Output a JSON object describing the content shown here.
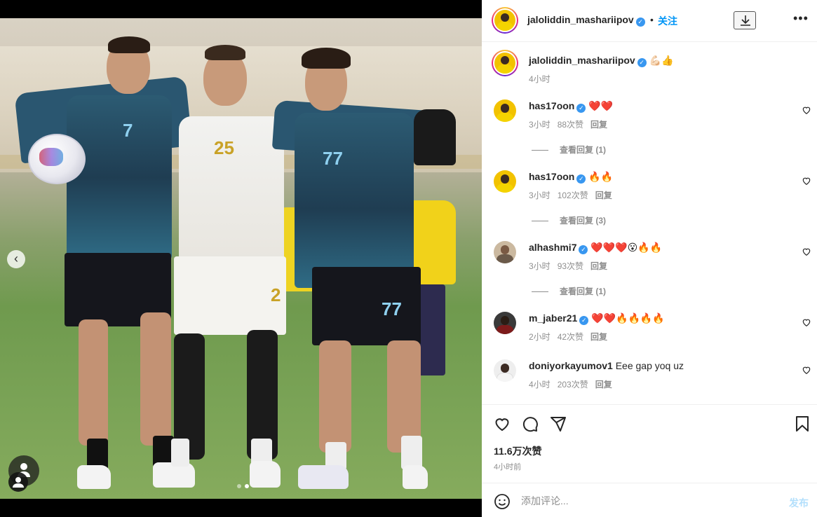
{
  "post": {
    "username": "jaloliddin_mashariipov",
    "follow_label": "关注",
    "bullet": "•",
    "caption_emoji": "💪🏻👍",
    "caption_time": "4小时"
  },
  "comments": [
    {
      "username": "has17oon",
      "text": "❤️❤️",
      "time": "3小时",
      "likes": "88次赞",
      "reply_label": "回复",
      "view_replies": "查看回复 (1)"
    },
    {
      "username": "has17oon",
      "text": "🔥🔥",
      "time": "3小时",
      "likes": "102次赞",
      "reply_label": "回复",
      "view_replies": "查看回复 (3)"
    },
    {
      "username": "alhashmi7",
      "text": "❤️❤️❤️😮🔥🔥",
      "time": "3小时",
      "likes": "93次赞",
      "reply_label": "回复",
      "view_replies": "查看回复 (1)"
    },
    {
      "username": "m_jaber21",
      "text": "❤️❤️🔥🔥🔥🔥",
      "time": "2小时",
      "likes": "42次赞",
      "reply_label": "回复"
    },
    {
      "username": "doniyorkayumov1",
      "text": "Eee gap yoq uz",
      "time": "4小时",
      "likes": "203次赞",
      "reply_label": "回复"
    }
  ],
  "actions": {
    "likes": "11.6万次赞",
    "time_ago": "4小时前"
  },
  "composer": {
    "placeholder": "添加评论...",
    "post_label": "发布"
  },
  "photo": {
    "jersey_numbers": [
      "7",
      "25",
      "77"
    ],
    "short_numbers": [
      "2",
      "77"
    ]
  },
  "colors": {
    "accent": "#0095f6",
    "verified": "#3897f0",
    "heart": "#ed4956"
  }
}
